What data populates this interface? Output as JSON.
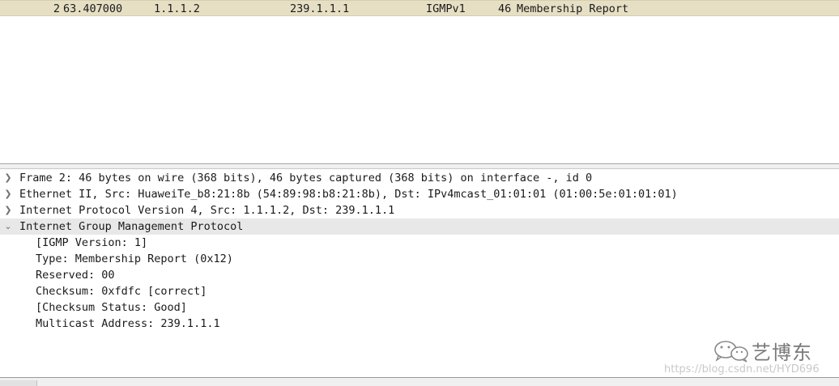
{
  "packet_list": {
    "selected_row": {
      "no": "2",
      "time": "63.407000",
      "source": "1.1.1.2",
      "destination": "239.1.1.1",
      "protocol": "IGMPv1",
      "length": "46",
      "info": "Membership Report"
    }
  },
  "details": {
    "collapsed": [
      "Frame 2: 46 bytes on wire (368 bits), 46 bytes captured (368 bits) on interface -, id 0",
      "Ethernet II, Src: HuaweiTe_b8:21:8b (54:89:98:b8:21:8b), Dst: IPv4mcast_01:01:01 (01:00:5e:01:01:01)",
      "Internet Protocol Version 4, Src: 1.1.1.2, Dst: 239.1.1.1"
    ],
    "expanded": "Internet Group Management Protocol",
    "children": [
      "[IGMP Version: 1]",
      "Type: Membership Report (0x12)",
      "Reserved: 00",
      "Checksum: 0xfdfc [correct]",
      "[Checksum Status: Good]",
      "Multicast Address: 239.1.1.1"
    ]
  },
  "watermark": {
    "name": "艺博东",
    "url": "https://blog.csdn.net/HYD696"
  },
  "icons": {
    "collapsed": "chevron-right-icon",
    "expanded": "chevron-down-icon",
    "logo": "wechat-logo-icon"
  }
}
